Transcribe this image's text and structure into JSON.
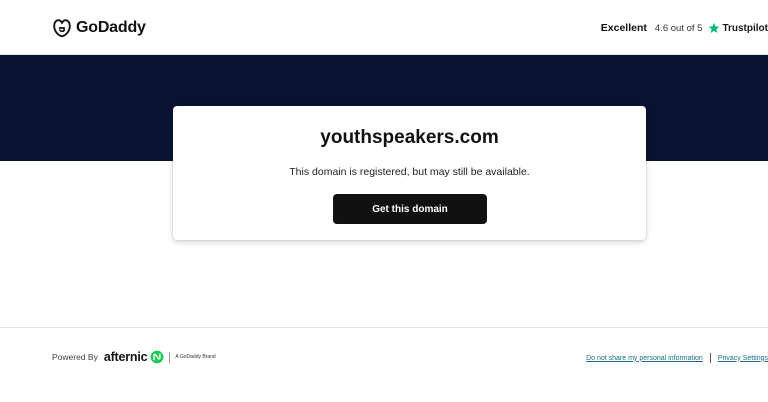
{
  "header": {
    "logo_text": "GoDaddy",
    "rating_label": "Excellent",
    "rating_score": "4.6 out of 5",
    "trustpilot_text": "Trustpilot"
  },
  "card": {
    "domain": "youthspeakers.com",
    "subtitle": "This domain is registered, but may still be available.",
    "button_label": "Get this domain"
  },
  "footer": {
    "powered_by": "Powered By",
    "afternic_text": "afternic",
    "brand_note": "A GoDaddy Brand",
    "links": [
      "Do not share my personal information",
      "Privacy Settings"
    ]
  },
  "colors": {
    "band": "#071330",
    "button": "#111111",
    "trustpilot_green": "#00b67a",
    "afternic_green": "#1ec95a",
    "link": "#1a6a8a"
  },
  "icons": [
    "godaddy-logo-icon",
    "trustpilot-star-icon",
    "afternic-logo-icon"
  ]
}
